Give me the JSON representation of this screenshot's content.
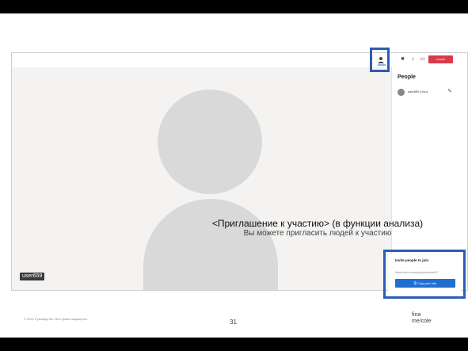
{
  "slide": {
    "footer_copyright": "© 2021 Руководство. Все права защищены.",
    "page_number": "31",
    "logo_text": "fina",
    "logo_text_2": "me/cole"
  },
  "caption": {
    "title": "<Приглашение к участию> (в функции анализа)",
    "subtitle": "Вы можете пригласить людей к участию"
  },
  "meeting": {
    "participant_tag": "user659",
    "toolbar": {
      "leave_label": "Leave"
    },
    "people_panel": {
      "title": "People",
      "participants": [
        {
          "name": "user659 (You)"
        }
      ]
    },
    "invite": {
      "title": "Invite people to join",
      "link": "https://meet.example/join/abcdef12",
      "copy_button": "Copy join info"
    }
  },
  "colors": {
    "highlight": "#2b5db6",
    "leave_button": "#d93a4a",
    "copy_button": "#1f6fd1"
  }
}
